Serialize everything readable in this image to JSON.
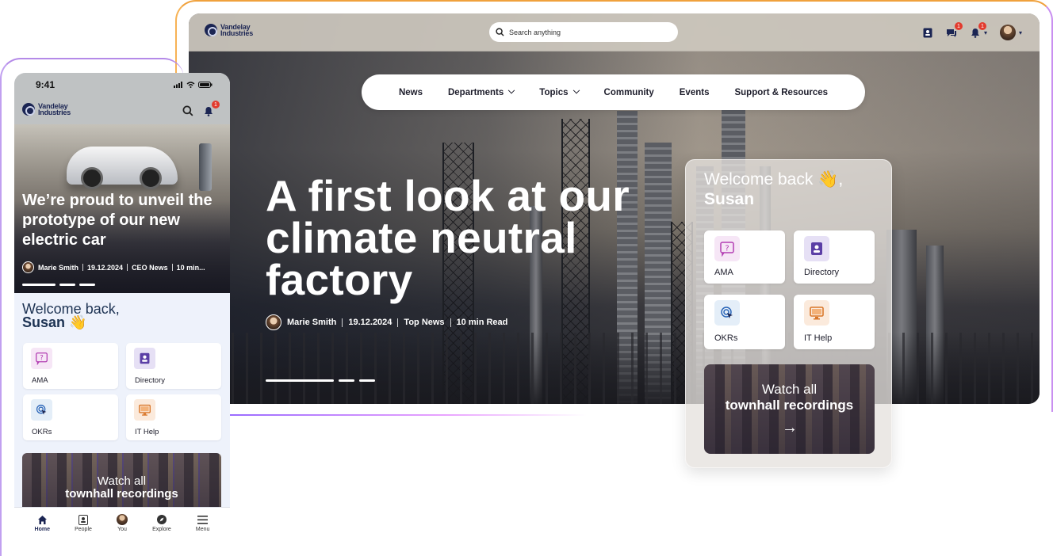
{
  "desktop": {
    "logo_line1": "Vandelay",
    "logo_line2": "Industries",
    "search_placeholder": "Search anything",
    "notifications_badge": "1",
    "messages_badge": "1",
    "nav": [
      "News",
      "Departments",
      "Topics",
      "Community",
      "Events",
      "Support & Resources"
    ],
    "hero": {
      "title_line1": "A first look at our",
      "title_line2": "climate neutral",
      "title_line3": "factory",
      "author": "Marie Smith",
      "date": "19.12.2024",
      "category": "Top News",
      "read_time": "10 min Read"
    },
    "welcome": {
      "greeting": "Welcome back 👋,",
      "name": "Susan",
      "tiles": [
        "AMA",
        "Directory",
        "OKRs",
        "IT Help"
      ],
      "townhall_line1": "Watch all",
      "townhall_line2": "townhall recordings",
      "townhall_arrow": "→"
    }
  },
  "mobile": {
    "time": "9:41",
    "logo_line1": "Vandelay",
    "logo_line2": "Industries",
    "notifications_badge": "1",
    "hero": {
      "title": "We’re proud to unveil the prototype of our new electric car",
      "author": "Marie Smith",
      "date": "19.12.2024",
      "category": "CEO News",
      "read_time": "10 min..."
    },
    "welcome": {
      "greeting": "Welcome back,",
      "name": "Susan 👋",
      "tiles": [
        "AMA",
        "Directory",
        "OKRs",
        "IT Help"
      ],
      "townhall_line1": "Watch all",
      "townhall_line2": "townhall recordings"
    },
    "tabs": [
      "Home",
      "People",
      "You",
      "Explore",
      "Menu"
    ]
  },
  "colors": {
    "brand_navy": "#1b2553",
    "badge_red": "#e23b2e",
    "accent_orange": "#f0a13c",
    "accent_purple": "#b48ae8"
  }
}
